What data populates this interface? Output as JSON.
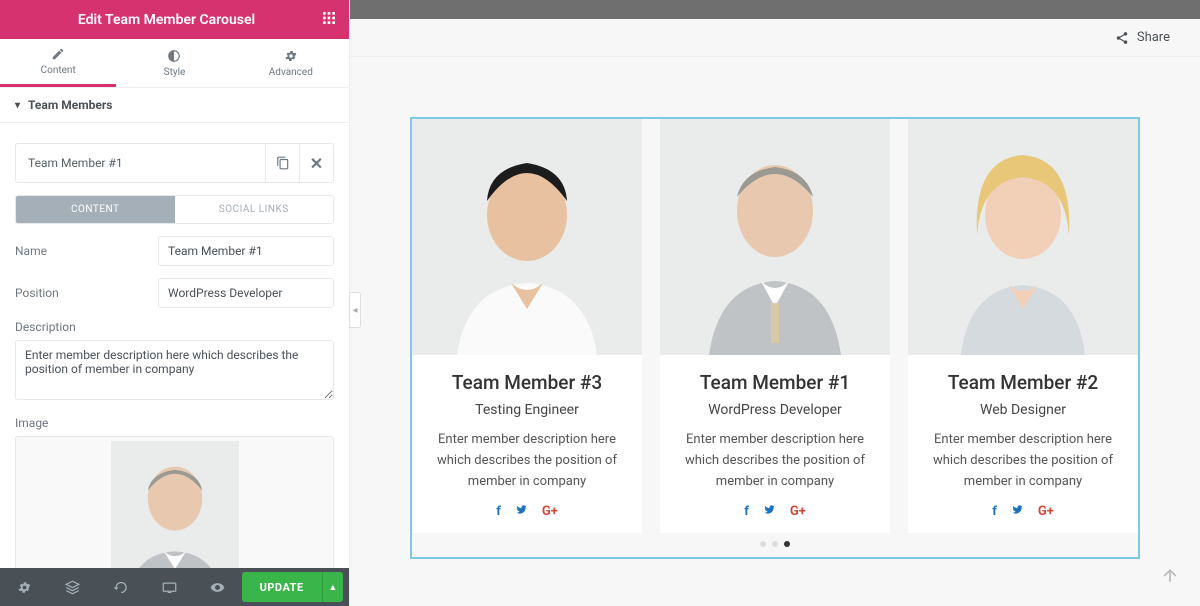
{
  "header": {
    "title": "Edit Team Member Carousel"
  },
  "tabs": {
    "content": "Content",
    "style": "Style",
    "advanced": "Advanced"
  },
  "section": {
    "team_members": "Team Members"
  },
  "item": {
    "title": "Team Member #1",
    "subtabs": {
      "content": "CONTENT",
      "social": "SOCIAL LINKS"
    },
    "fields": {
      "name_label": "Name",
      "name_value": "Team Member #1",
      "position_label": "Position",
      "position_value": "WordPress Developer",
      "description_label": "Description",
      "description_value": "Enter member description here which describes the position of member in company",
      "image_label": "Image"
    }
  },
  "footer": {
    "update": "UPDATE"
  },
  "share": {
    "label": "Share"
  },
  "cards": [
    {
      "name": "Team Member #3",
      "position": "Testing Engineer",
      "desc": "Enter member description here which describes the position of member in company"
    },
    {
      "name": "Team Member #1",
      "position": "WordPress Developer",
      "desc": "Enter member description here which describes the position of member in company"
    },
    {
      "name": "Team Member #2",
      "position": "Web Designer",
      "desc": "Enter member description here which describes the position of member in company"
    }
  ],
  "social": {
    "fb": "f",
    "tw": "𝕏",
    "gp": "G+"
  }
}
